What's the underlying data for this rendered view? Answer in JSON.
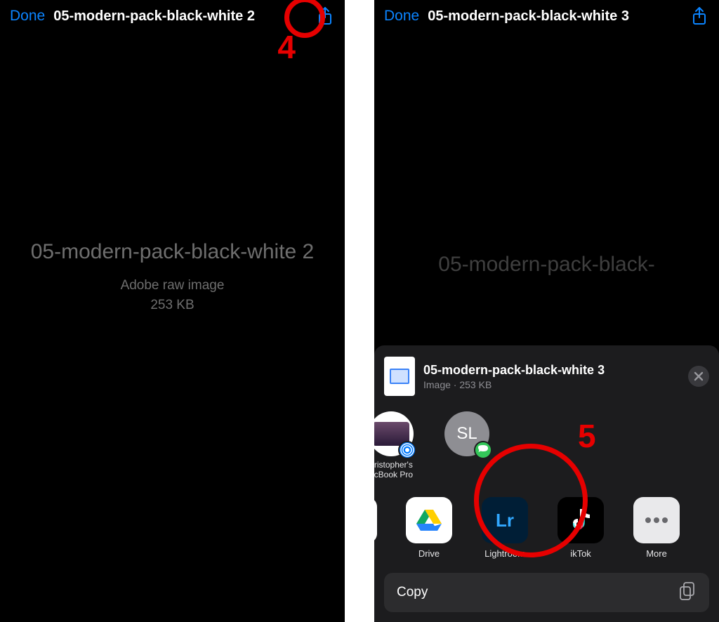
{
  "left": {
    "done_label": "Done",
    "title": "05-modern-pack-black-white 2",
    "bigname": "05-modern-pack-black-white 2",
    "filetype": "Adobe raw image",
    "filesize": "253 KB",
    "annotation_number": "4"
  },
  "right": {
    "done_label": "Done",
    "title": "05-modern-pack-black-white 3",
    "bigname": "05-modern-pack-black-",
    "sheet": {
      "title": "05-modern-pack-black-white 3",
      "subtitle": "Image · 253 KB",
      "airdrop_contacts": [
        {
          "label": "hristopher's\nacBook Pro",
          "initials": "",
          "badge": "airdrop"
        },
        {
          "label": "",
          "initials": "SL",
          "badge": "messages"
        }
      ],
      "apps": [
        {
          "label": "Drive",
          "kind": "drive"
        },
        {
          "label": "Lightroom",
          "kind": "lr"
        },
        {
          "label": "ikTok",
          "kind": "tiktok"
        },
        {
          "label": "More",
          "kind": "more"
        }
      ],
      "actions": {
        "copy": "Copy"
      }
    },
    "annotation_number": "5"
  }
}
